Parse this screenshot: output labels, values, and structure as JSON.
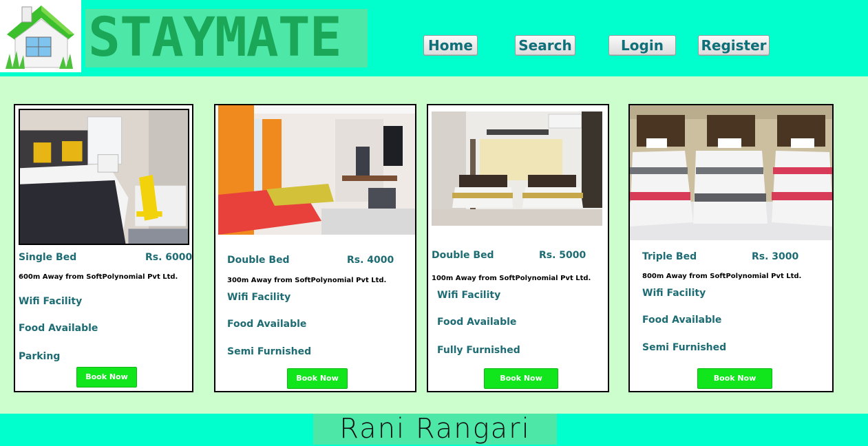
{
  "brand": {
    "name": "STAYMATE"
  },
  "nav": [
    "Home",
    "Search",
    "Login",
    "Register"
  ],
  "cards": [
    {
      "title": "Single Bed",
      "price": "Rs. 6000",
      "distance": "600m Away from SoftPolynomial Pvt Ltd.",
      "features": [
        "Wifi Facility",
        "Food Available",
        "Parking"
      ],
      "button": "Book Now"
    },
    {
      "title": "Double Bed",
      "price": "Rs. 4000",
      "distance": "300m Away from SoftPolynomial Pvt Ltd.",
      "features": [
        "Wifi Facility",
        "Food Available",
        "Semi Furnished"
      ],
      "button": "Book Now"
    },
    {
      "title": "Double Bed",
      "price": "Rs. 5000",
      "distance": "100m Away from SoftPolynomial Pvt Ltd.",
      "features": [
        "Wifi Facility",
        "Food Available",
        "Fully Furnished"
      ],
      "button": "Book Now"
    },
    {
      "title": "Triple Bed",
      "price": "Rs. 3000",
      "distance": "800m Away from SoftPolynomial Pvt Ltd.",
      "features": [
        "Wifi Facility",
        "Food Available",
        "Semi Furnished"
      ],
      "button": "Book Now"
    }
  ],
  "footer": {
    "name": "Rani Rangari"
  },
  "colors": {
    "header": "#00ffcc",
    "page": "#ccfdcc",
    "accent_text": "#1d6b73",
    "button": "#11e61d"
  }
}
